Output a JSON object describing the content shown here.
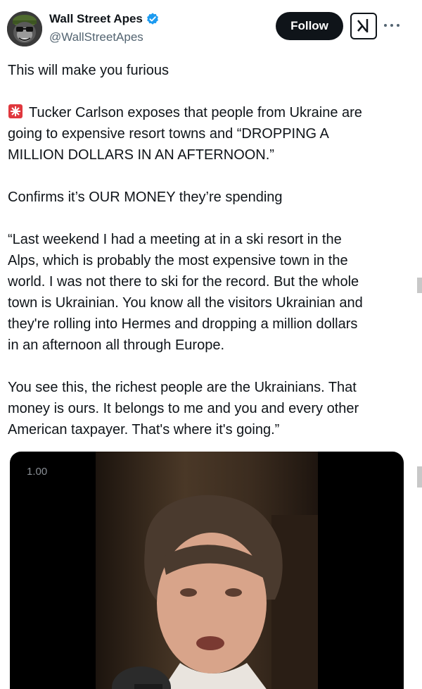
{
  "author": {
    "display_name": "Wall Street Apes",
    "handle": "@WallStreetApes",
    "verified": true
  },
  "actions": {
    "follow_label": "Follow"
  },
  "tweet": {
    "paragraphs": [
      "This will make you furious",
      "Tucker Carlson exposes that people from Ukraine are\ngoing to expensive resort towns and “DROPPING A\nMILLION DOLLARS IN AN AFTERNOON.”",
      "Confirms it’s OUR MONEY they’re spending",
      "“Last weekend I had a meeting at in a ski resort in the\nAlps, which is probably the most expensive town in the\nworld. I was not there to ski for the record. But the whole\ntown is Ukrainian. You know all the visitors Ukrainian and\nthey're rolling into Hermes and dropping a million dollars\nin an afternoon all through Europe.",
      "You see this, the richest people are the Ukrainians. That\nmoney is ours. It belongs to me and you and every other\nAmerican taxpayer. That's where it's going.”"
    ],
    "siren_icon": "rotating-light-icon"
  },
  "media": {
    "playback_speed": "1.00"
  },
  "colors": {
    "text": "#0f1419",
    "secondary": "#536471",
    "verified": "#1d9bf0",
    "follow_bg": "#0f1419"
  }
}
